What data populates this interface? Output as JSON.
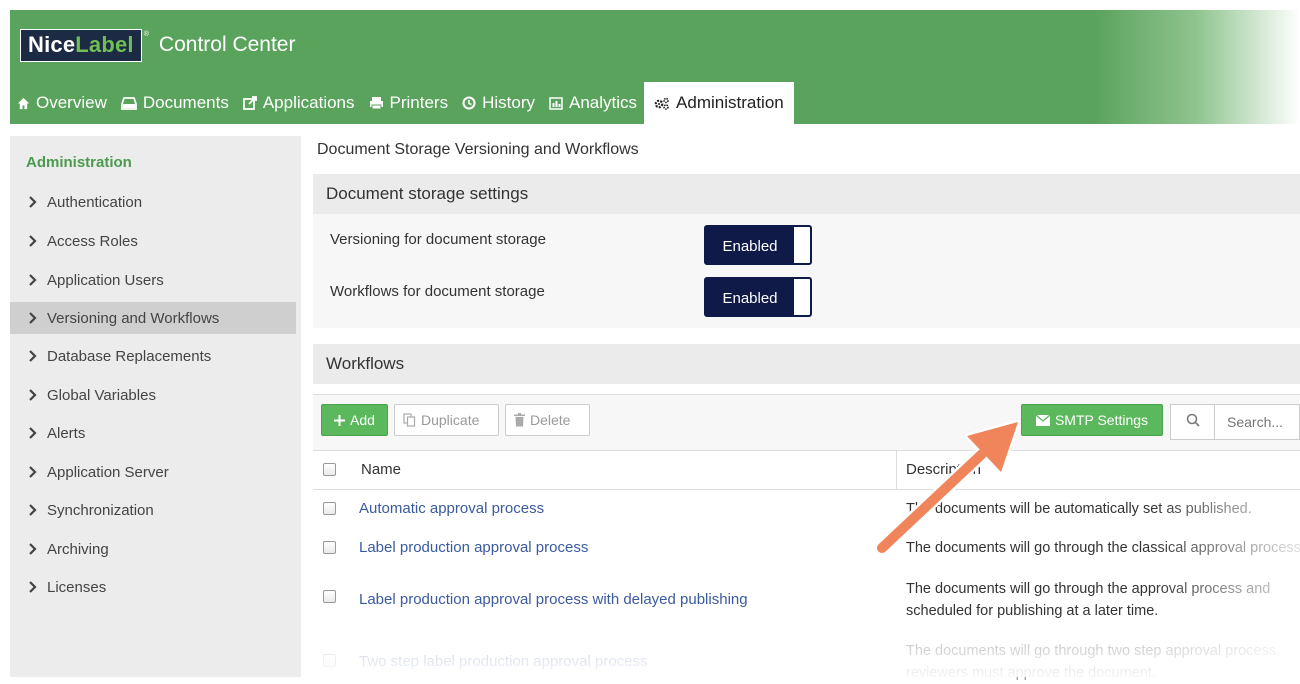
{
  "app": {
    "logo_nice": "Nice",
    "logo_label": "Label",
    "logo_reg": "®",
    "title": "Control Center"
  },
  "tabs": [
    {
      "label": "Overview",
      "icon": "home-icon"
    },
    {
      "label": "Documents",
      "icon": "drive-icon"
    },
    {
      "label": "Applications",
      "icon": "external-link-icon"
    },
    {
      "label": "Printers",
      "icon": "printer-icon"
    },
    {
      "label": "History",
      "icon": "clock-icon"
    },
    {
      "label": "Analytics",
      "icon": "bar-chart-icon"
    },
    {
      "label": "Administration",
      "icon": "cogs-icon",
      "active": true
    }
  ],
  "sidebar": {
    "title": "Administration",
    "items": [
      {
        "label": "Authentication"
      },
      {
        "label": "Access Roles"
      },
      {
        "label": "Application Users"
      },
      {
        "label": "Versioning and Workflows",
        "active": true
      },
      {
        "label": "Database Replacements"
      },
      {
        "label": "Global Variables"
      },
      {
        "label": "Alerts"
      },
      {
        "label": "Application Server"
      },
      {
        "label": "Synchronization"
      },
      {
        "label": "Archiving"
      },
      {
        "label": "Licenses"
      }
    ]
  },
  "main": {
    "page_title": "Document Storage Versioning and Workflows",
    "storage_section": "Document storage settings",
    "settings": [
      {
        "label": "Versioning for document storage",
        "state": "Enabled"
      },
      {
        "label": "Workflows for document storage",
        "state": "Enabled"
      }
    ],
    "workflows_section": "Workflows",
    "toolbar": {
      "add": "Add",
      "duplicate": "Duplicate",
      "delete": "Delete",
      "smtp": "SMTP Settings",
      "search_placeholder": "Search..."
    },
    "table": {
      "headers": [
        "Name",
        "Description"
      ],
      "rows": [
        {
          "name": "Automatic approval process",
          "desc": [
            "The documents will be automatically set as published."
          ]
        },
        {
          "name": "Label production approval process",
          "desc": [
            "The documents will go through the classical approval process."
          ]
        },
        {
          "name": "Label production approval process with delayed publishing",
          "desc": [
            "The documents will go through the approval process and",
            "scheduled for publishing at a later time."
          ]
        },
        {
          "name": "Two step label production approval process",
          "desc": [
            "The documents will go through two step approval process,",
            "reviewers must approve the document."
          ]
        }
      ]
    }
  },
  "colors": {
    "header_green": "#5aa35c",
    "accent_green": "#5cb85c",
    "toggle_navy": "#0f1a48",
    "link_blue": "#3a5b9e",
    "arrow_orange": "#f0845a"
  }
}
